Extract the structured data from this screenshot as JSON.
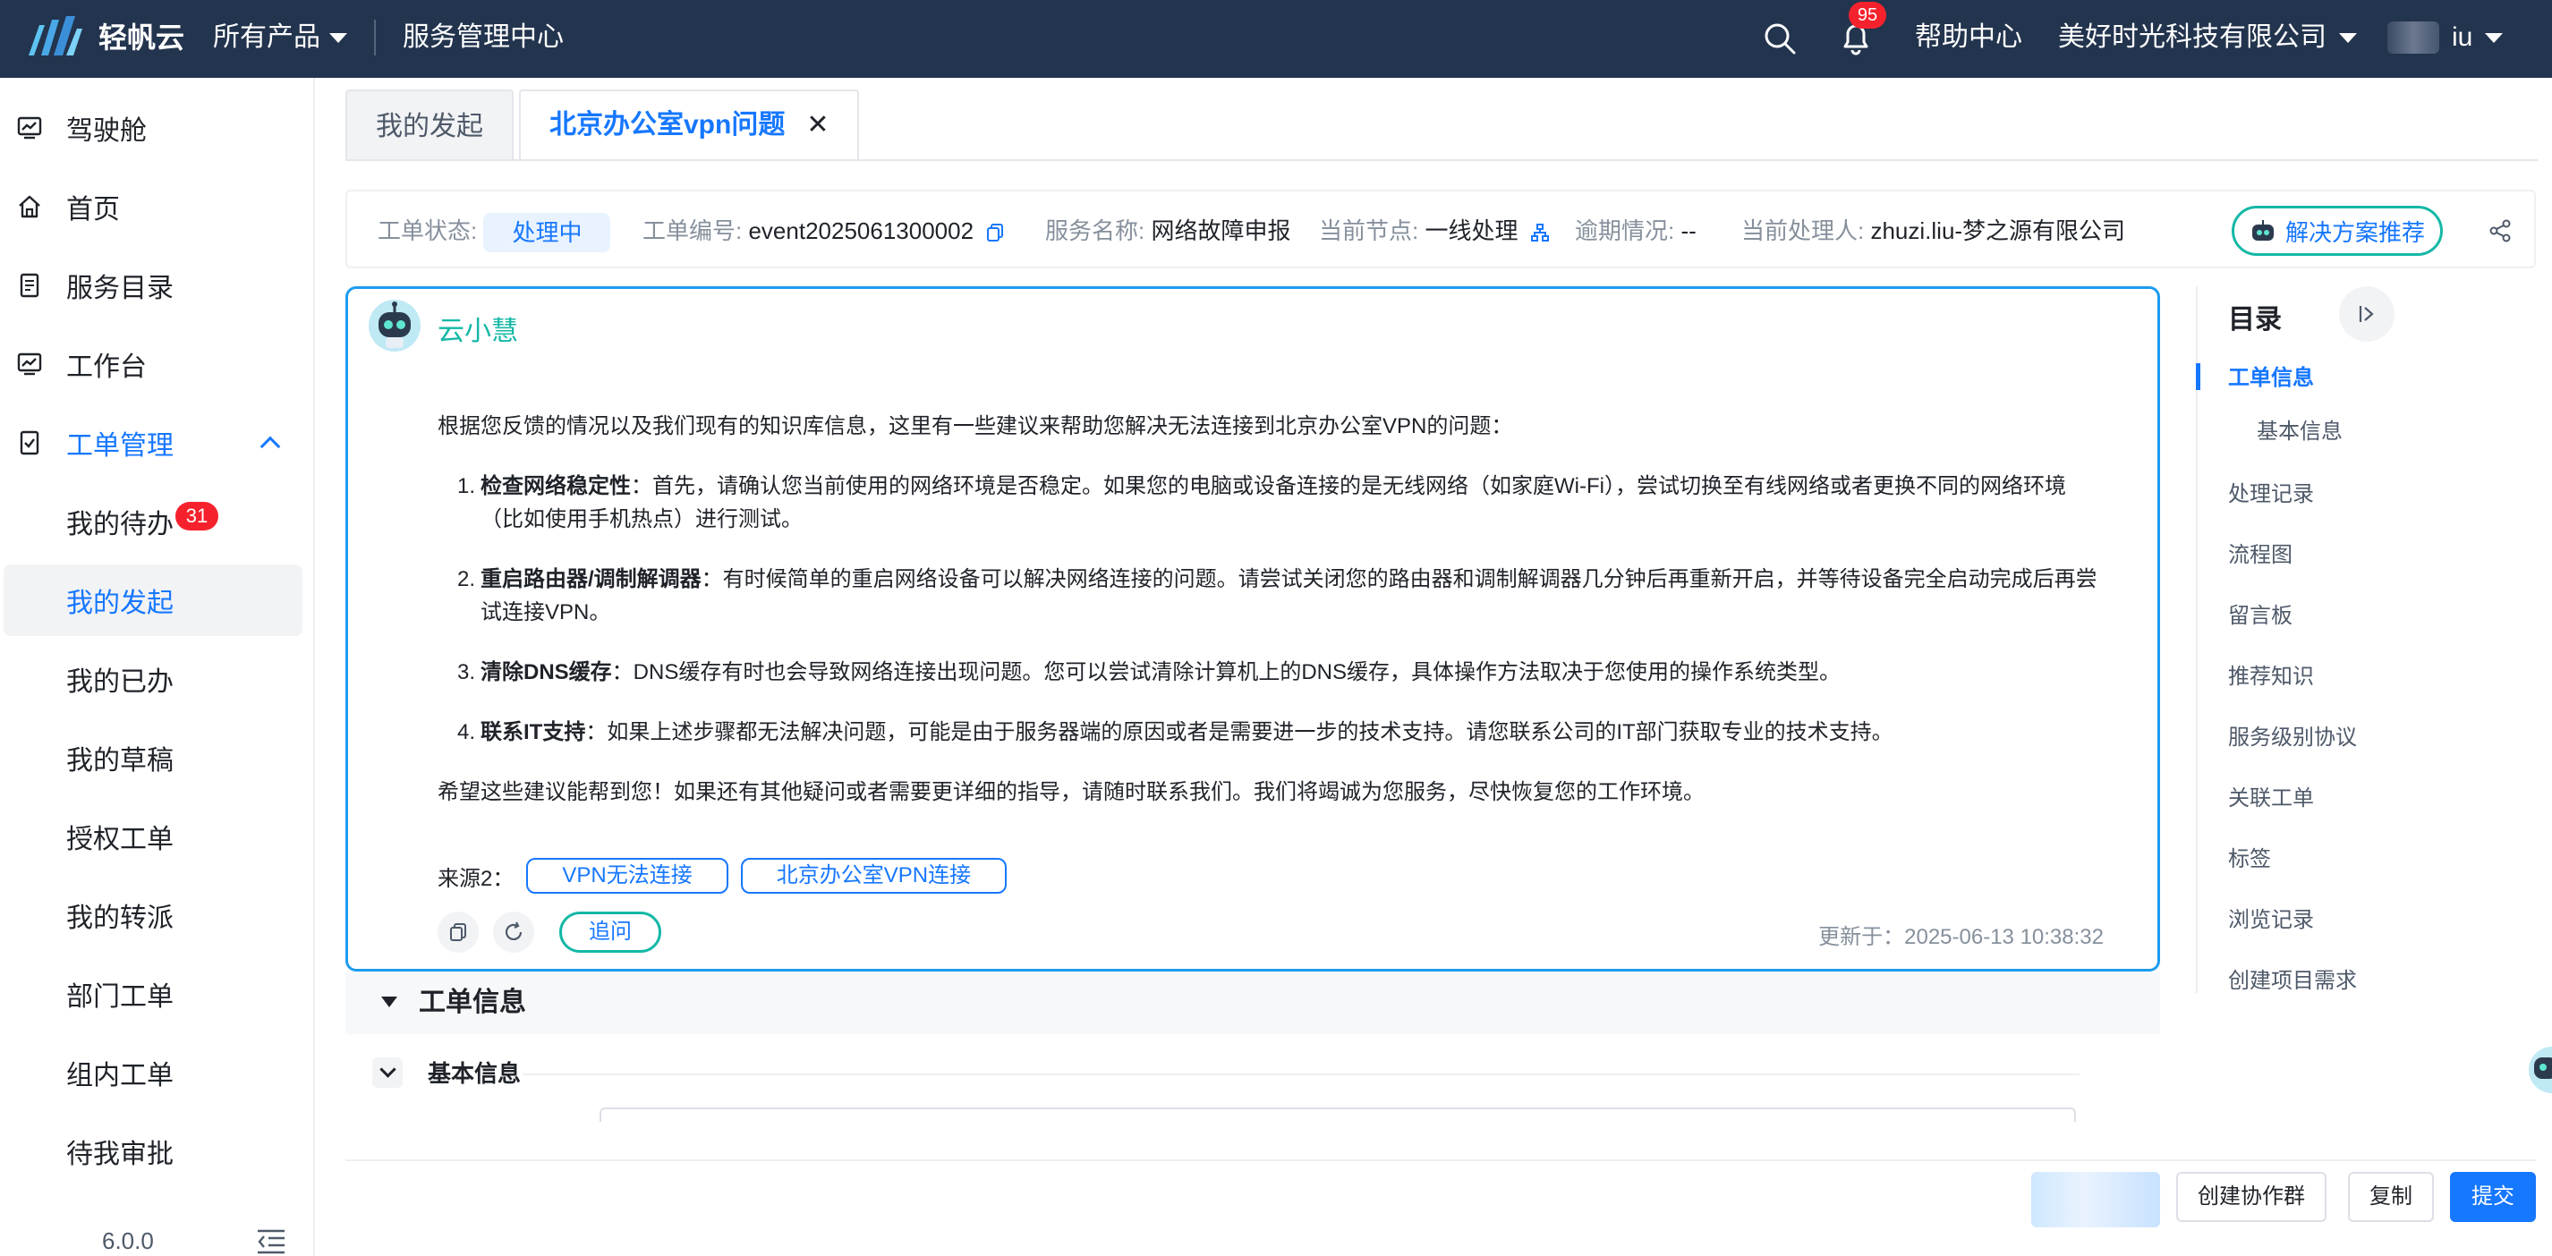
{
  "topbar": {
    "brand": "轻帆云",
    "products": "所有产品",
    "service_center": "服务管理中心",
    "notification_count": "95",
    "help": "帮助中心",
    "company": "美好时光科技有限公司",
    "user_suffix": "iu",
    "icons": [
      "logo-icon",
      "search-icon",
      "bell-icon",
      "chevron-down-icon"
    ]
  },
  "sidebar": {
    "items": [
      {
        "label": "驾驶舱",
        "icon": "dashboard-icon"
      },
      {
        "label": "首页",
        "icon": "home-icon"
      },
      {
        "label": "服务目录",
        "icon": "catalog-icon"
      },
      {
        "label": "工作台",
        "icon": "workbench-icon"
      },
      {
        "label": "工单管理",
        "icon": "ticket-icon"
      }
    ],
    "sub_items": [
      {
        "label": "我的待办",
        "badge": "31"
      },
      {
        "label": "我的发起"
      },
      {
        "label": "我的已办"
      },
      {
        "label": "我的草稿"
      },
      {
        "label": "授权工单"
      },
      {
        "label": "我的转派"
      },
      {
        "label": "部门工单"
      },
      {
        "label": "组内工单"
      },
      {
        "label": "待我审批"
      }
    ],
    "version": "6.0.0"
  },
  "tabs": [
    {
      "label": "我的发起",
      "active": false
    },
    {
      "label": "北京办公室vpn问题",
      "active": true
    }
  ],
  "status": {
    "state_label": "工单状态:",
    "state_value": "处理中",
    "number_label": "工单编号:",
    "number_value": "event2025061300002",
    "service_label": "服务名称:",
    "service_value": "网络故障申报",
    "node_label": "当前节点:",
    "node_value": "一线处理",
    "overdue_label": "逾期情况:",
    "overdue_value": "--",
    "handler_label": "当前处理人:",
    "handler_value": "zhuzi.liu-梦之源有限公司",
    "solution_button": "解决方案推荐"
  },
  "ai": {
    "name": "云小慧",
    "intro": "根据您反馈的情况以及我们现有的知识库信息，这里有一些建议来帮助您解决无法连接到北京办公室VPN的问题：",
    "steps": [
      {
        "num": "1.",
        "key": "检查网络稳定性",
        "text": "：首先，请确认您当前使用的网络环境是否稳定。如果您的电脑或设备连接的是无线网络（如家庭Wi-Fi），尝试切换至有线网络或者更换不同的网络环境（比如使用手机热点）进行测试。"
      },
      {
        "num": "2.",
        "key": "重启路由器/调制解调器",
        "text": "：有时候简单的重启网络设备可以解决网络连接的问题。请尝试关闭您的路由器和调制解调器几分钟后再重新开启，并等待设备完全启动完成后再尝试连接VPN。"
      },
      {
        "num": "3.",
        "key": "清除DNS缓存",
        "text": "：DNS缓存有时也会导致网络连接出现问题。您可以尝试清除计算机上的DNS缓存，具体操作方法取决于您使用的操作系统类型。"
      },
      {
        "num": "4.",
        "key": "联系IT支持",
        "text": "：如果上述步骤都无法解决问题，可能是由于服务器端的原因或者是需要进一步的技术支持。请您联系公司的IT部门获取专业的技术支持。"
      }
    ],
    "closing": "希望这些建议能帮到您！如果还有其他疑问或者需要更详细的指导，请随时联系我们。我们将竭诚为您服务，尽快恢复您的工作环境。",
    "source_label": "来源2：",
    "sources": [
      "VPN无法连接",
      "北京办公室VPN连接"
    ],
    "ask_button": "追问",
    "updated": "更新于：2025-06-13 10:38:32"
  },
  "work_order": {
    "section_title": "工单信息",
    "basic_title": "基本信息"
  },
  "toc": {
    "title": "目录",
    "items": [
      {
        "label": "工单信息",
        "active": true
      },
      {
        "label": "基本信息",
        "sub": true
      },
      {
        "label": "处理记录"
      },
      {
        "label": "流程图"
      },
      {
        "label": "留言板"
      },
      {
        "label": "推荐知识"
      },
      {
        "label": "服务级别协议"
      },
      {
        "label": "关联工单"
      },
      {
        "label": "标签"
      },
      {
        "label": "浏览记录"
      },
      {
        "label": "创建项目需求"
      }
    ]
  },
  "actions": {
    "create_group": "创建协作群",
    "copy": "复制",
    "submit": "提交"
  },
  "colors": {
    "topbar": "#23344e",
    "primary": "#1677ff",
    "teal": "#14b8a6",
    "badge": "#f5222d"
  }
}
